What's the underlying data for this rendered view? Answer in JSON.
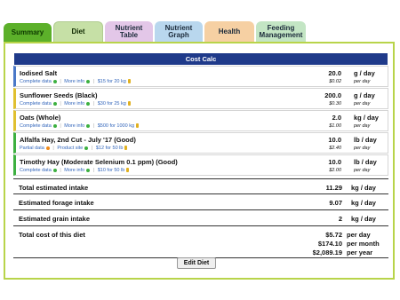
{
  "tabs": [
    {
      "label": "Summary"
    },
    {
      "label": "Diet"
    },
    {
      "label": "Nutrient\nTable"
    },
    {
      "label": "Nutrient\nGraph"
    },
    {
      "label": "Health"
    },
    {
      "label": "Feeding\nManagement"
    }
  ],
  "panel_title": "Cost Calc",
  "items": [
    {
      "name": "Iodised Salt",
      "link1": "Complete data",
      "link2": "More info",
      "price": "$15 for 20 kg",
      "qty": "20.0",
      "qty_unit": "g / day",
      "cost": "$0.02",
      "cost_unit": "per day",
      "accent": "#4a78c8"
    },
    {
      "name": "Sunflower Seeds (Black)",
      "link1": "Complete data",
      "link2": "More info",
      "price": "$30 for 25 kg",
      "qty": "200.0",
      "qty_unit": "g / day",
      "cost": "$0.30",
      "cost_unit": "per day",
      "accent": "#e0c030"
    },
    {
      "name": "Oats (Whole)",
      "link1": "Complete data",
      "link2": "More info",
      "price": "$500 for 1000 kg",
      "qty": "2.0",
      "qty_unit": "kg / day",
      "cost": "$1.00",
      "cost_unit": "per day",
      "accent": "#e0c030"
    },
    {
      "name": "Alfalfa Hay, 2nd Cut - July '17 (Good)",
      "link1": "Partial data",
      "link2": "Product site",
      "price": "$12 for 50 lb",
      "qty": "10.0",
      "qty_unit": "lb / day",
      "cost": "$2.40",
      "cost_unit": "per day",
      "accent": "#3db040"
    },
    {
      "name": "Timothy Hay (Moderate Selenium 0.1 ppm) (Good)",
      "link1": "Complete data",
      "link2": "More info",
      "price": "$10 for 50 lb",
      "qty": "10.0",
      "qty_unit": "lb / day",
      "cost": "$2.00",
      "cost_unit": "per day",
      "accent": "#3db040"
    }
  ],
  "totals": {
    "intake_label": "Total estimated intake",
    "intake_val": "11.29",
    "intake_unit": "kg / day",
    "forage_label": "Estimated forage intake",
    "forage_val": "9.07",
    "forage_unit": "kg / day",
    "grain_label": "Estimated grain intake",
    "grain_val": "2",
    "grain_unit": "kg / day"
  },
  "cost": {
    "label": "Total cost of this diet",
    "day_val": "$5.72",
    "day_unit": "per day",
    "month_val": "$174.10",
    "month_unit": "per month",
    "year_val": "$2,089.19",
    "year_unit": "per year"
  },
  "edit_button": "Edit Diet"
}
